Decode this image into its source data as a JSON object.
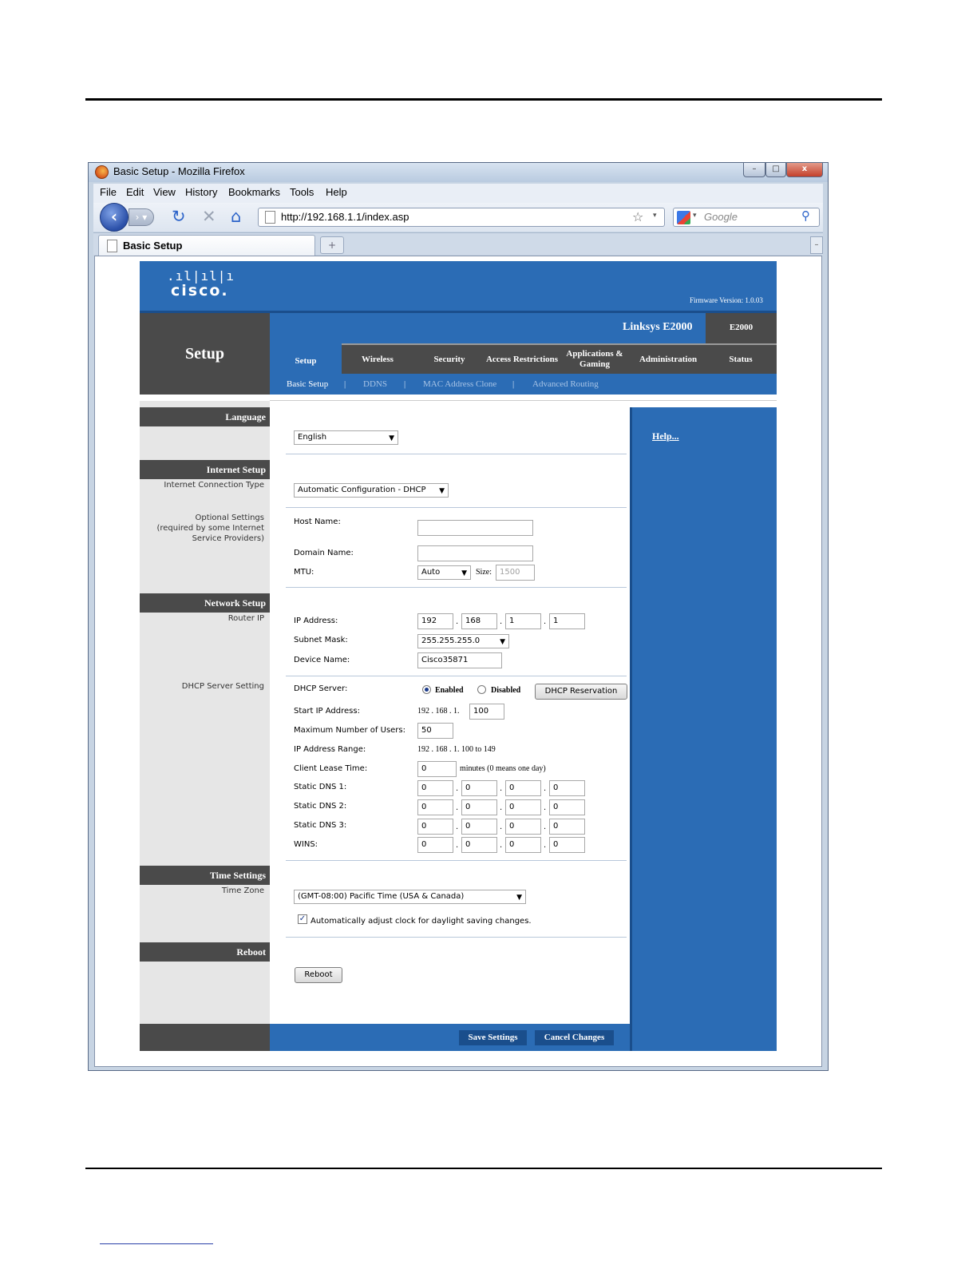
{
  "browser": {
    "window_title": "Basic Setup - Mozilla Firefox",
    "menu": [
      "File",
      "Edit",
      "View",
      "History",
      "Bookmarks",
      "Tools",
      "Help"
    ],
    "url": "http://192.168.1.1/index.asp",
    "search_placeholder": "Google",
    "tab_title": "Basic Setup",
    "new_tab_glyph": "+",
    "window_buttons": {
      "minimize": "–",
      "maximize": "□",
      "close": "x"
    }
  },
  "header": {
    "logo_bars": ".ıl|ıl|ı",
    "logo": "cisco.",
    "firmware": "Firmware Version: 1.0.03",
    "section_title": "Setup",
    "model_name": "Linksys E2000",
    "model_code": "E2000"
  },
  "nav": {
    "tabs": [
      "Setup",
      "Wireless",
      "Security",
      "Access Restrictions",
      "Applications &\nGaming",
      "Administration",
      "Status"
    ],
    "subtabs": [
      "Basic Setup",
      "DDNS",
      "MAC Address Clone",
      "Advanced Routing"
    ],
    "separator": "|"
  },
  "sections": {
    "language": "Language",
    "internet_setup": "Internet Setup",
    "internet_connection_type": "Internet Connection Type",
    "optional_settings": "Optional Settings\n(required by some Internet\nService Providers)",
    "network_setup": "Network Setup",
    "router_ip": "Router IP",
    "dhcp_server_setting": "DHCP Server Setting",
    "time_settings": "Time Settings",
    "time_zone": "Time Zone",
    "reboot": "Reboot"
  },
  "help_link": "Help...",
  "form": {
    "language_value": "English",
    "connection_type_value": "Automatic Configuration - DHCP",
    "host_name_label": "Host Name:",
    "host_name_value": "",
    "domain_name_label": "Domain Name:",
    "domain_name_value": "",
    "mtu_label": "MTU:",
    "mtu_value": "Auto",
    "size_label": "Size:",
    "size_value": "1500",
    "ip_address_label": "IP Address:",
    "ip_address": [
      "192",
      "168",
      "1",
      "1"
    ],
    "subnet_mask_label": "Subnet Mask:",
    "subnet_mask_value": "255.255.255.0",
    "device_name_label": "Device Name:",
    "device_name_value": "Cisco35871",
    "dhcp_server_label": "DHCP Server:",
    "dhcp_enabled_label": "Enabled",
    "dhcp_disabled_label": "Disabled",
    "dhcp_reservation_button": "DHCP Reservation",
    "start_ip_label": "Start IP Address:",
    "start_ip_prefix": "192 . 168 . 1.",
    "start_ip_value": "100",
    "max_users_label": "Maximum Number of Users:",
    "max_users_value": "50",
    "ip_range_label": "IP Address Range:",
    "ip_range_value": "192 . 168 . 1. 100 to 149",
    "lease_time_label": "Client Lease Time:",
    "lease_time_value": "0",
    "lease_time_note": "minutes (0 means one day)",
    "static_dns1_label": "Static DNS 1:",
    "static_dns2_label": "Static DNS 2:",
    "static_dns3_label": "Static DNS 3:",
    "wins_label": "WINS:",
    "static_dns1": [
      "0",
      "0",
      "0",
      "0"
    ],
    "static_dns2": [
      "0",
      "0",
      "0",
      "0"
    ],
    "static_dns3": [
      "0",
      "0",
      "0",
      "0"
    ],
    "wins": [
      "0",
      "0",
      "0",
      "0"
    ],
    "time_zone_value": "(GMT-08:00) Pacific Time (USA & Canada)",
    "auto_dst_label": "Automatically adjust clock for daylight saving changes.",
    "reboot_button": "Reboot",
    "dot": "."
  },
  "actions": {
    "save": "Save Settings",
    "cancel": "Cancel Changes"
  },
  "colors": {
    "accent_blue": "#2b6cb5",
    "dark_gray": "#4a4a4a",
    "light_gray": "#e6e6e6"
  }
}
